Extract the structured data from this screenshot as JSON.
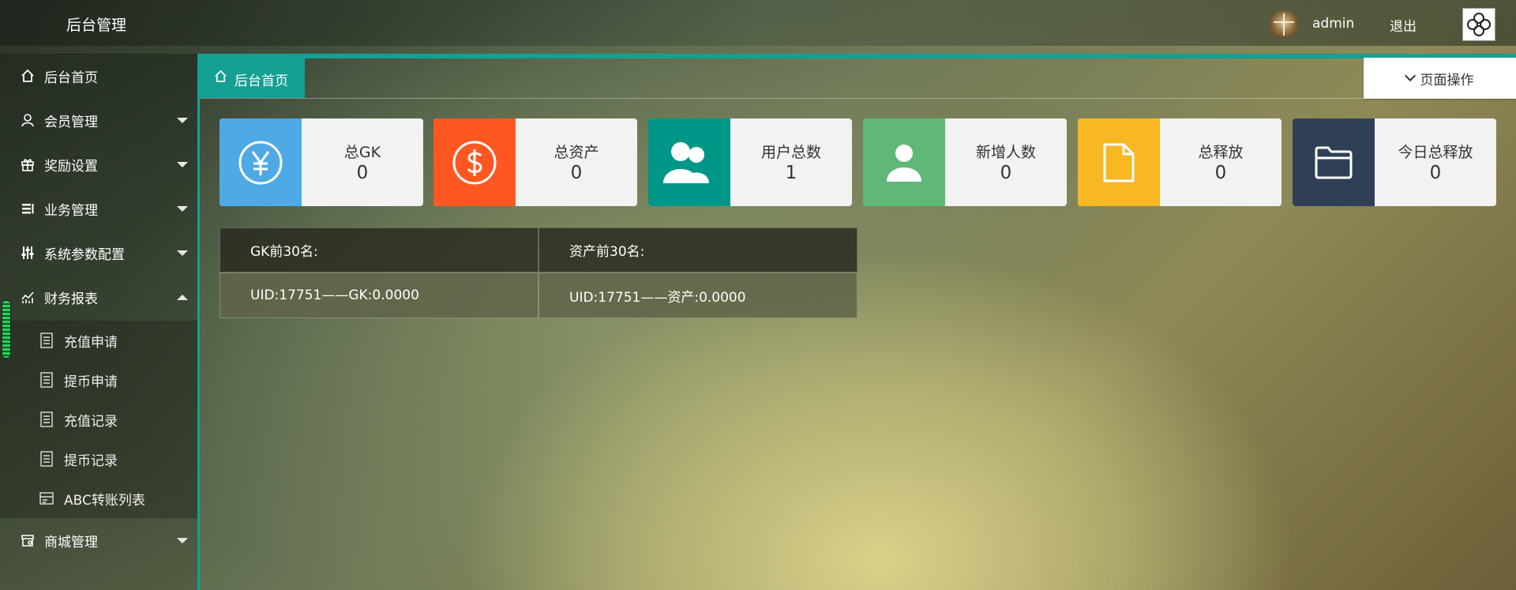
{
  "header": {
    "title": "后台管理",
    "user_name": "admin",
    "logout_label": "退出"
  },
  "sidebar": {
    "items": [
      {
        "label": "后台首页",
        "icon": "home-icon"
      },
      {
        "label": "会员管理",
        "icon": "user-icon"
      },
      {
        "label": "奖励设置",
        "icon": "gift-icon"
      },
      {
        "label": "业务管理",
        "icon": "list-icon"
      },
      {
        "label": "系统参数配置",
        "icon": "sliders-icon"
      },
      {
        "label": "财务报表",
        "icon": "chart-icon"
      },
      {
        "label": "商城管理",
        "icon": "shop-icon"
      }
    ],
    "finance_sub": [
      {
        "label": "充值申请"
      },
      {
        "label": "提币申请"
      },
      {
        "label": "充值记录"
      },
      {
        "label": "提币记录"
      },
      {
        "label": "ABC转账列表"
      }
    ]
  },
  "tabs": {
    "home_label": "后台首页",
    "page_ops_label": "页面操作"
  },
  "stats": [
    {
      "label": "总GK",
      "value": "0",
      "color": "#4fa9e5",
      "icon": "yen-icon"
    },
    {
      "label": "总资产",
      "value": "0",
      "color": "#ff5722",
      "icon": "dollar-icon"
    },
    {
      "label": "用户总数",
      "value": "1",
      "color": "#009688",
      "icon": "users-icon"
    },
    {
      "label": "新增人数",
      "value": "0",
      "color": "#5fb878",
      "icon": "user-add-icon"
    },
    {
      "label": "总释放",
      "value": "0",
      "color": "#f7b824",
      "icon": "file-icon"
    },
    {
      "label": "今日总释放",
      "value": "0",
      "color": "#2f4056",
      "icon": "folder-icon"
    }
  ],
  "ranking": {
    "headers": [
      "GK前30名:",
      "资产前30名:"
    ],
    "rows": [
      [
        "UID:17751——GK:0.0000",
        "UID:17751——资产:0.0000"
      ]
    ]
  },
  "colors": {
    "accent": "#14a092"
  }
}
